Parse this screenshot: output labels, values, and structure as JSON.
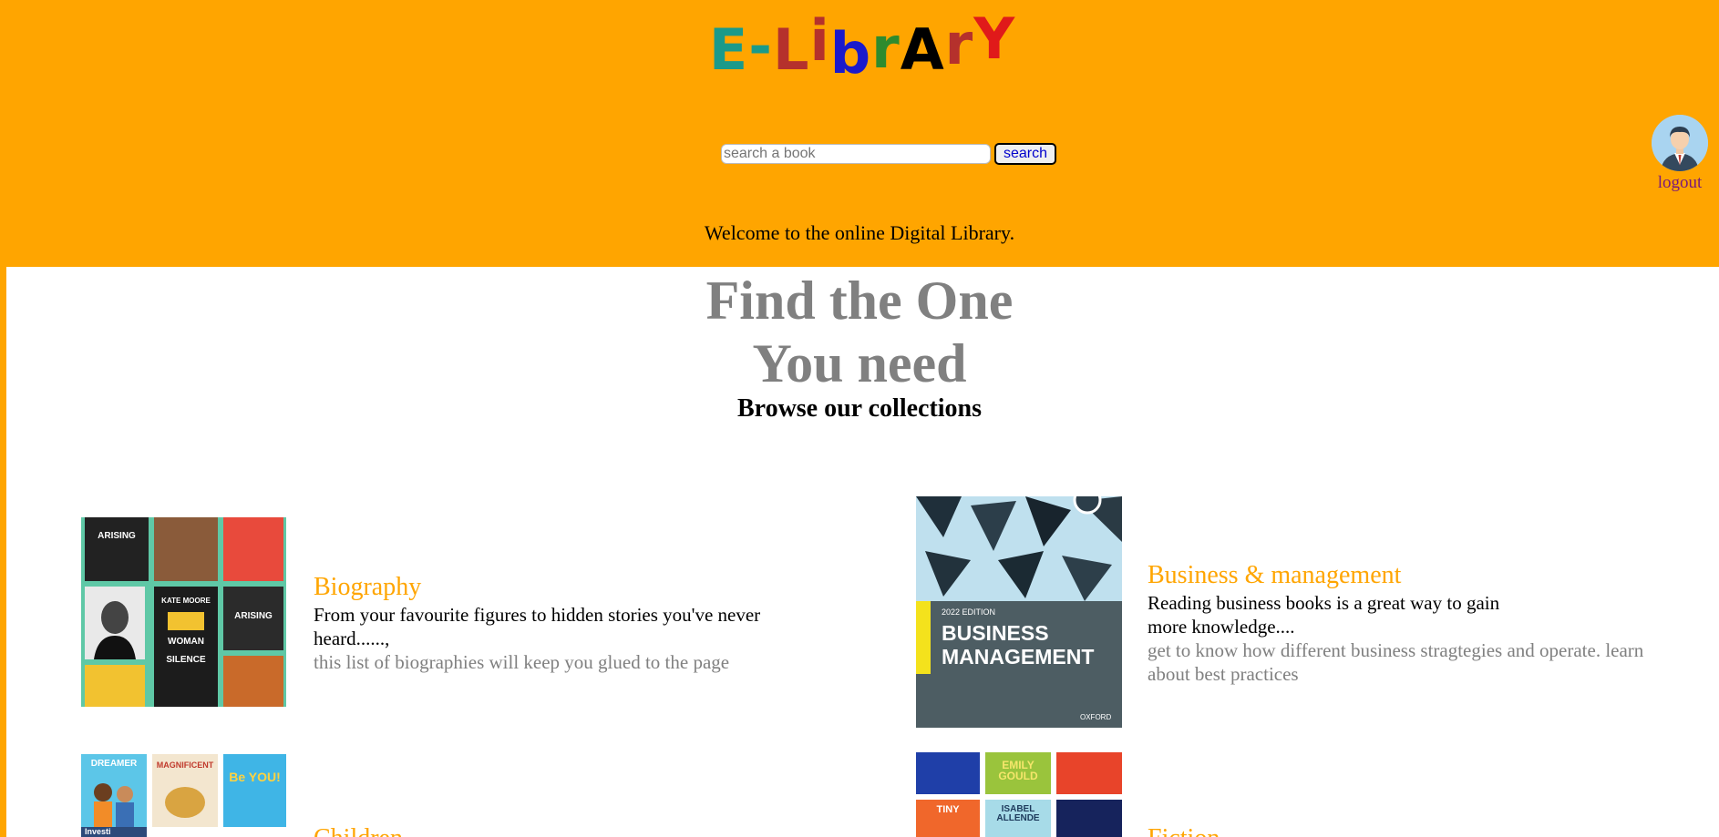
{
  "logo": {
    "letters": [
      {
        "char": "E",
        "color": "#1a9a8a"
      },
      {
        "char": "-",
        "color": "#1a9a8a"
      },
      {
        "char": "L",
        "color": "#b5312c"
      },
      {
        "char": "i",
        "color": "#b5312c"
      },
      {
        "char": "b",
        "color": "#1a1acc"
      },
      {
        "char": "r",
        "color": "#2e8b2e"
      },
      {
        "char": "A",
        "color": "#000000"
      },
      {
        "char": "r",
        "color": "#b5312c"
      },
      {
        "char": "Y",
        "color": "#e01a1a"
      }
    ]
  },
  "search": {
    "placeholder": "search a book",
    "value": "",
    "button_label": "search"
  },
  "user": {
    "logout_label": "logout"
  },
  "welcome_text": "Welcome to the online Digital Library.",
  "hero": {
    "title_line1": "Find the One",
    "title_line2": "You need",
    "subtitle": "Browse our collections"
  },
  "categories": [
    {
      "title": "Biography",
      "description": "From your favourite figures to hidden stories you've never heard......,",
      "more": "this list of biographies will keep you glued to the page",
      "cover_texts": [
        "ARISING",
        "KATE MOORE",
        "WOMAN",
        "SILENCE",
        "ARISING"
      ]
    },
    {
      "title": "Business & management",
      "description": "Reading business books is a great way to gain more knowledge....",
      "more": "get to know how different business stragtegies and operate. learn about best practices",
      "cover_texts": [
        "2022 EDITION",
        "BUSINESS",
        "MANAGEMENT",
        "OXFORD"
      ]
    },
    {
      "title": "Children",
      "cover_texts": [
        "DREAMER",
        "MAGNIFICENT",
        "Be YOU!",
        "Investi"
      ]
    },
    {
      "title": "Fiction",
      "cover_texts": [
        "EMILY GOULD",
        "TINY",
        "ISABEL ALLENDE"
      ]
    }
  ],
  "colors": {
    "page_background": "#ffa500",
    "content_background": "#ffffff",
    "category_title": "#ffa500",
    "hero_title": "#808080"
  }
}
